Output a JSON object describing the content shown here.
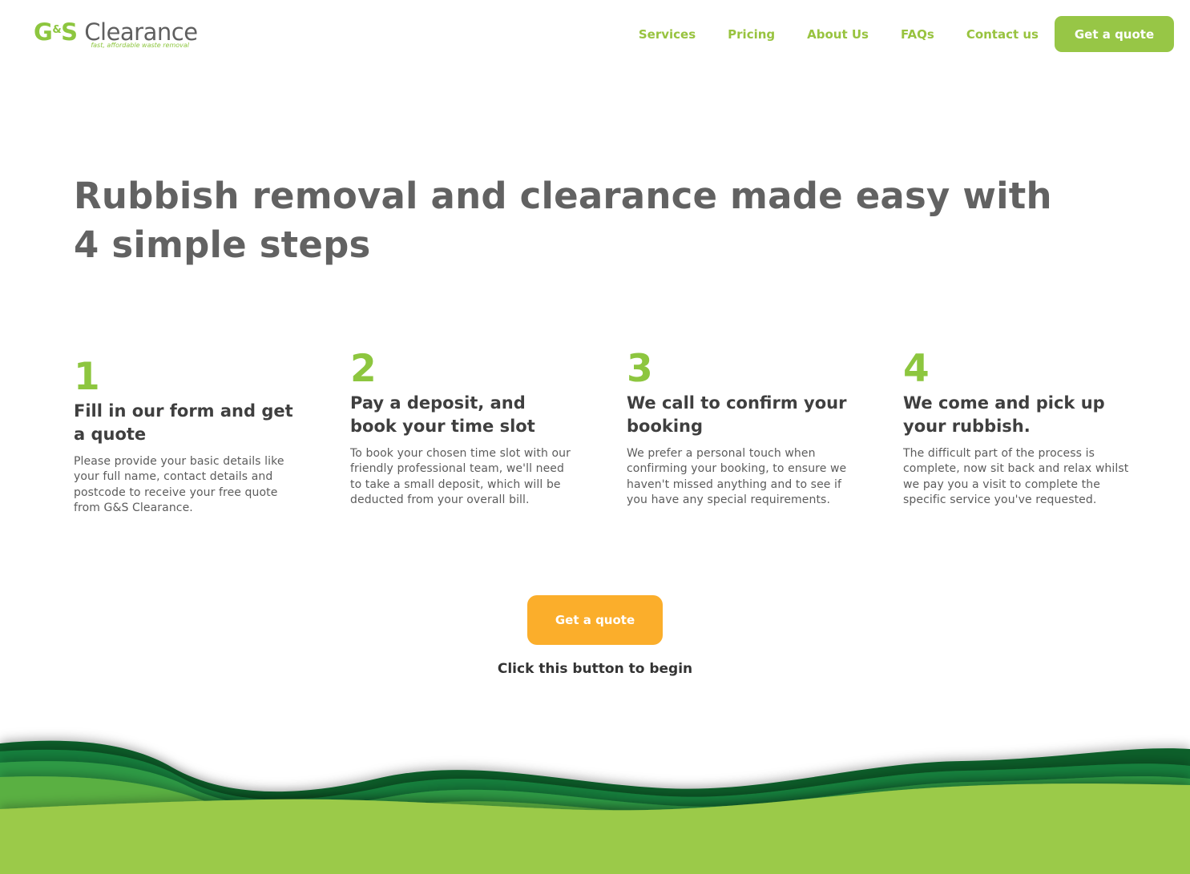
{
  "header": {
    "logo": {
      "letter_g": "G",
      "ampersand": "&",
      "letter_s": "S",
      "word": "Clearance",
      "tagline": "fast, affordable waste removal"
    },
    "nav": [
      {
        "label": "Services"
      },
      {
        "label": "Pricing"
      },
      {
        "label": "About Us"
      },
      {
        "label": "FAQs"
      },
      {
        "label": "Contact us"
      }
    ],
    "cta_label": "Get a quote"
  },
  "hero": {
    "title": "Rubbish removal and clearance made easy with 4 simple steps"
  },
  "steps": [
    {
      "number": "1",
      "title": "Fill in our form and get a quote",
      "text": "Please provide your basic details like your full name, contact details and postcode to receive your free quote from G&S Clearance."
    },
    {
      "number": "2",
      "title": "Pay a deposit, and book your time slot",
      "text": "To book your chosen time slot with our friendly professional team, we'll need to take a small deposit, which will be deducted from your overall bill."
    },
    {
      "number": "3",
      "title": "We call to confirm your booking",
      "text": "We prefer a personal touch when confirming your booking, to ensure we haven't missed anything and to see if you have any special requirements."
    },
    {
      "number": "4",
      "title": "We come and pick up your rubbish.",
      "text": "The difficult part of the process is complete, now sit back and relax whilst we pay you a visit to complete the specific service you've requested."
    }
  ],
  "cta": {
    "button_label": "Get a quote",
    "caption": "Click this button to begin"
  },
  "colors": {
    "brand_green": "#8dc63f",
    "nav_green": "#98c33f",
    "cta_orange": "#fbae2b",
    "heading_gray": "#626262",
    "wave_dark": "#0b6b2f",
    "wave_light": "#9bca48"
  }
}
